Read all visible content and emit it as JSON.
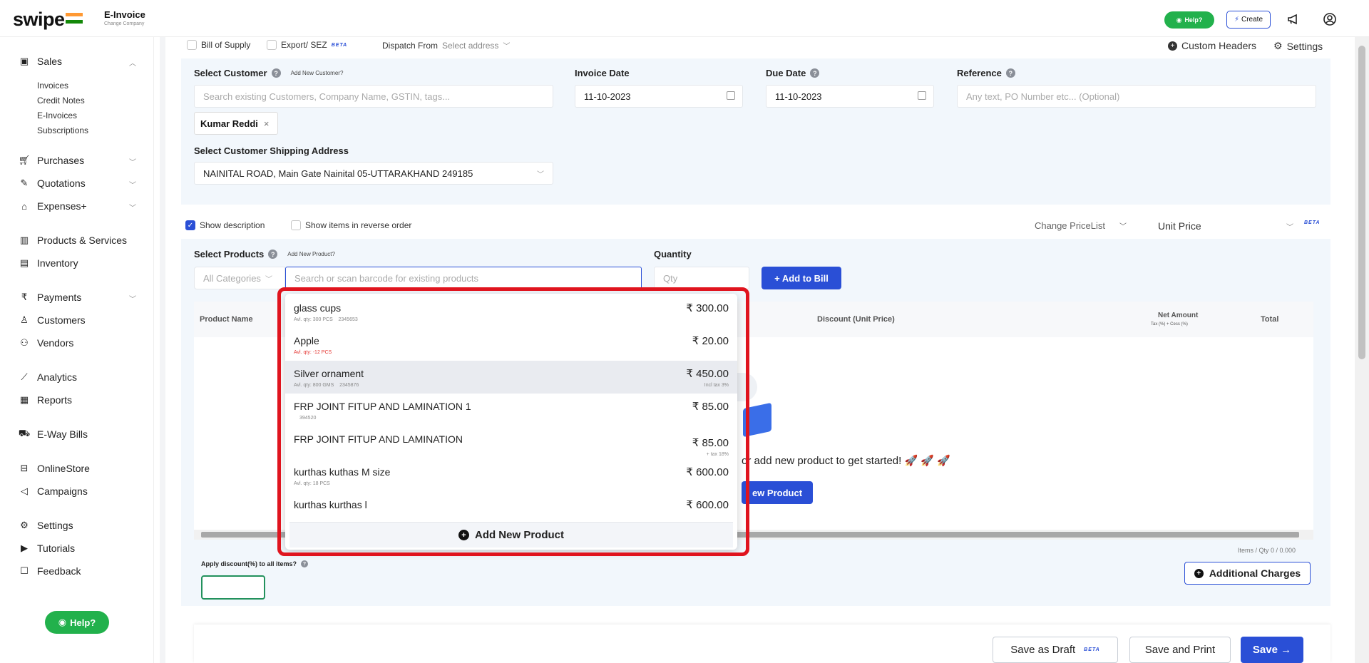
{
  "header": {
    "logo": "swipe",
    "app_title": "E-Invoice",
    "app_subtitle": "Change Company",
    "help_label": "Help?",
    "create_label": "Create"
  },
  "sidebar": {
    "sales": "Sales",
    "sales_sub": [
      "Invoices",
      "Credit Notes",
      "E-Invoices",
      "Subscriptions"
    ],
    "purchases": "Purchases",
    "quotations": "Quotations",
    "expenses": "Expenses+",
    "products": "Products & Services",
    "inventory": "Inventory",
    "payments": "Payments",
    "customers": "Customers",
    "vendors": "Vendors",
    "analytics": "Analytics",
    "reports": "Reports",
    "eway": "E-Way Bills",
    "onlinestore": "OnlineStore",
    "campaigns": "Campaigns",
    "settings": "Settings",
    "tutorials": "Tutorials",
    "feedback": "Feedback",
    "help": "Help?"
  },
  "options": {
    "bill_of_supply": "Bill of Supply",
    "export_sez": "Export/ SEZ",
    "beta": "BETA",
    "dispatch_from": "Dispatch From",
    "select_address": "Select address",
    "custom_headers": "Custom Headers",
    "settings": "Settings"
  },
  "customer": {
    "label": "Select Customer",
    "add_new": "Add New Customer?",
    "search_placeholder": "Search existing Customers, Company Name, GSTIN, tags...",
    "chip": "Kumar Reddi",
    "shipping_label": "Select Customer Shipping Address",
    "shipping_value": "NAINITAL ROAD, Main Gate Nainital 05-UTTARAKHAND 249185"
  },
  "dates": {
    "invoice_label": "Invoice Date",
    "invoice_value": "11-10-2023",
    "due_label": "Due Date",
    "due_value": "11-10-2023"
  },
  "reference": {
    "label": "Reference",
    "placeholder": "Any text, PO Number etc... (Optional)"
  },
  "items_opts": {
    "show_description": "Show description",
    "reverse_order": "Show items in reverse order",
    "change_pricelist": "Change PriceList",
    "unit_price": "Unit Price",
    "beta": "BETA"
  },
  "products": {
    "label": "Select Products",
    "add_new": "Add New Product?",
    "category": "All Categories",
    "search_placeholder": "Search or scan barcode for existing products",
    "quantity_label": "Quantity",
    "qty_placeholder": "Qty",
    "add_to_bill": "+ Add to Bill"
  },
  "table": {
    "product_name": "Product Name",
    "discount": "Discount (Unit Price)",
    "net_amount": "Net Amount",
    "net_sub": "Tax (%) + Cess (%)",
    "total": "Total",
    "empty_msg": "or add new product to get started! 🚀 🚀 🚀",
    "new_product_btn": "ew Product",
    "items_qty": "Items / Qty 0 / 0.000"
  },
  "dropdown": {
    "items": [
      {
        "name": "glass cups",
        "price": "₹ 300.00",
        "meta_a": "Avl. qty: 300  PCS",
        "meta_b": "2345653",
        "tax": ""
      },
      {
        "name": "Apple",
        "price": "₹ 20.00",
        "meta_a": "Avl. qty: -12  PCS",
        "meta_b": "",
        "tax": ""
      },
      {
        "name": "Silver ornament",
        "price": "₹ 450.00",
        "meta_a": "Avl. qty: 800  GMS",
        "meta_b": "2345876",
        "tax": "Incl tax 3%"
      },
      {
        "name": "FRP JOINT FITUP AND LAMINATION 1",
        "price": "₹ 85.00",
        "meta_a": "",
        "meta_b": "394520",
        "tax": ""
      },
      {
        "name": "FRP JOINT FITUP AND LAMINATION",
        "price": "₹ 85.00",
        "meta_a": "",
        "meta_b": "",
        "tax": "+ tax 18%"
      },
      {
        "name": "kurthas kuthas M size",
        "price": "₹ 600.00",
        "meta_a": "Avl. qty: 18  PCS",
        "meta_b": "",
        "tax": ""
      },
      {
        "name": "kurthas kurthas l",
        "price": "₹ 600.00",
        "meta_a": "",
        "meta_b": "",
        "tax": ""
      }
    ],
    "add_new_product": "Add New Product"
  },
  "footer": {
    "apply_discount": "Apply discount(%) to all items?",
    "additional_charges": "Additional Charges",
    "save_draft": "Save as Draft",
    "beta": "BETA",
    "save_print": "Save and Print",
    "save": "Save →"
  },
  "colors": {
    "accent": "#2a4fd6",
    "green": "#22b14c",
    "highlight_box": "#e0141e"
  }
}
